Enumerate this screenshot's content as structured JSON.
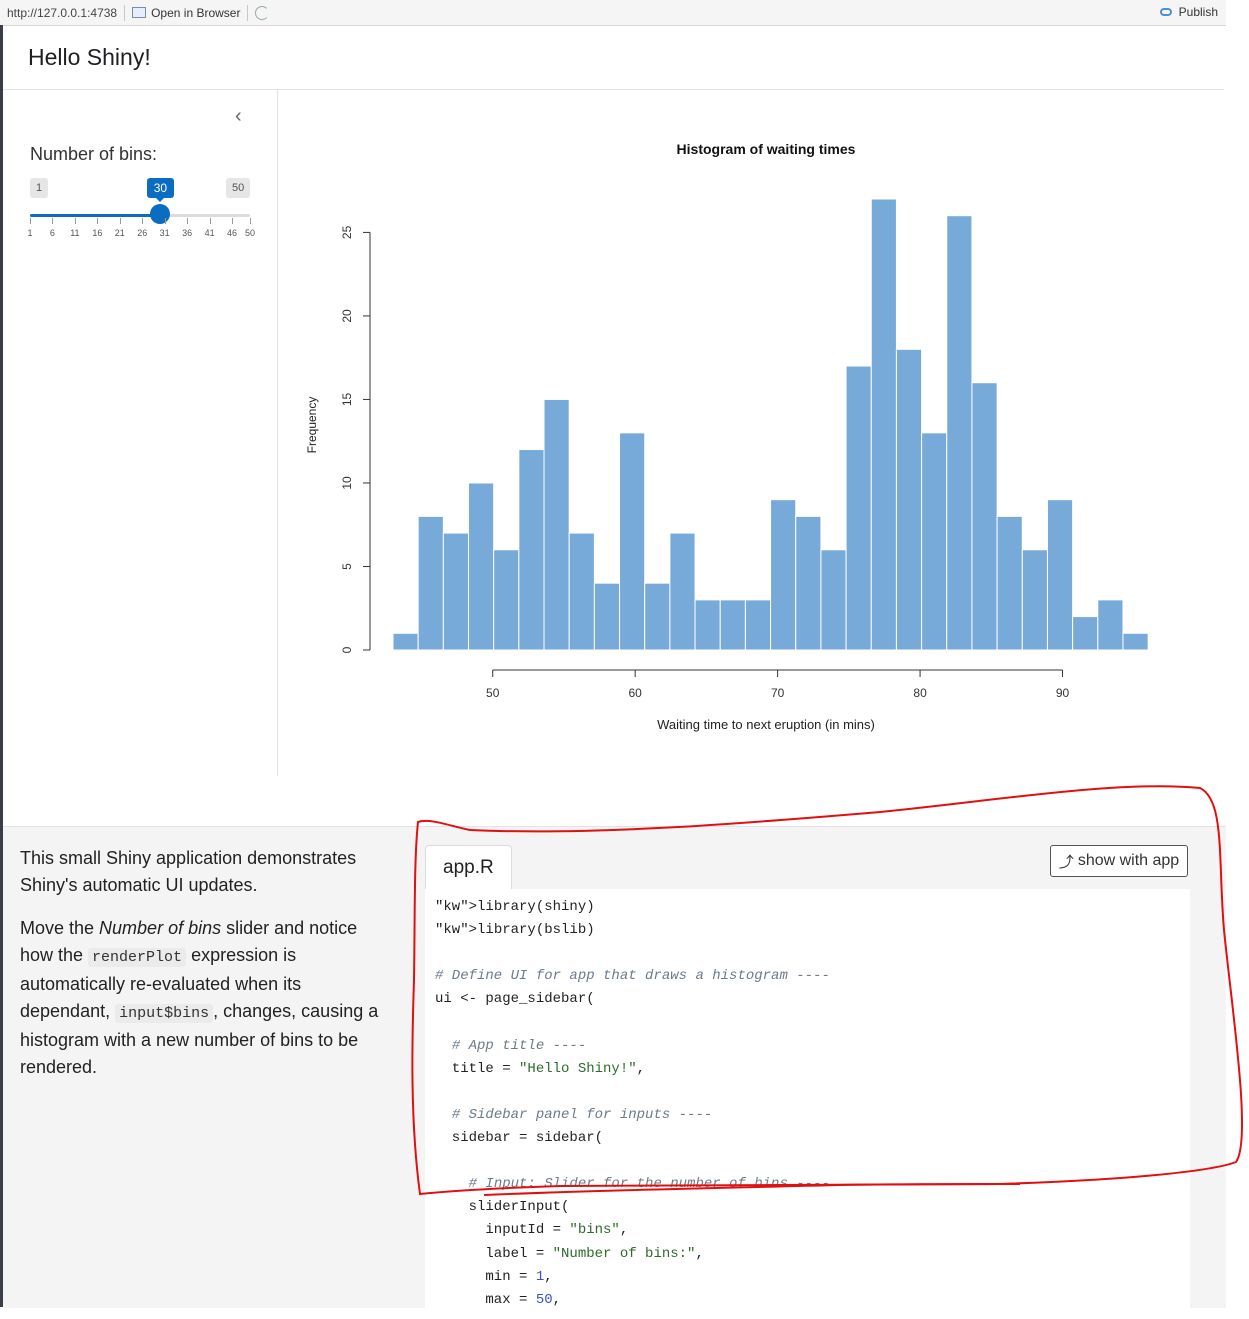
{
  "toolbar": {
    "url": "http://127.0.0.1:4738",
    "open_browser": "Open in Browser",
    "publish": "Publish"
  },
  "app": {
    "title": "Hello Shiny!"
  },
  "sidebar": {
    "slider_label": "Number of bins:",
    "min": 1,
    "max": 50,
    "value": 30,
    "min_label": "1",
    "max_label": "50",
    "value_label": "30",
    "tick_labels": [
      "1",
      "6",
      "11",
      "16",
      "21",
      "26",
      "31",
      "36",
      "41",
      "46",
      "50"
    ]
  },
  "chart_data": {
    "type": "bar",
    "title": "Histogram of waiting times",
    "xlabel": "Waiting time to next eruption (in mins)",
    "ylabel": "Frequency",
    "xlim": [
      43,
      96
    ],
    "ylim": [
      0,
      27
    ],
    "x_ticks": [
      50,
      60,
      70,
      80,
      90
    ],
    "y_ticks": [
      0,
      5,
      10,
      15,
      20,
      25
    ],
    "bin_start": 43.0,
    "bin_width": 1.767,
    "values": [
      1,
      8,
      7,
      10,
      6,
      12,
      15,
      7,
      4,
      13,
      4,
      7,
      3,
      3,
      3,
      9,
      8,
      6,
      17,
      27,
      18,
      13,
      26,
      16,
      8,
      6,
      9,
      2,
      3,
      1
    ],
    "bar_color": "#77a9d9"
  },
  "description": {
    "p1": "This small Shiny application demonstrates Shiny's automatic UI updates.",
    "p2_a": "Move the ",
    "p2_em": "Number of bins",
    "p2_b": " slider and notice how the ",
    "p2_code1": "renderPlot",
    "p2_c": " expression is automatically re-evaluated when its dependant, ",
    "p2_code2": "input$bins",
    "p2_d": ", changes, causing a histogram with a new number of bins to be rendered."
  },
  "code_panel": {
    "tab": "app.R",
    "show_with_app": "show with app",
    "lines": [
      "library(shiny)",
      "library(bslib)",
      "",
      "# Define UI for app that draws a histogram ----",
      "ui <- page_sidebar(",
      "",
      "  # App title ----",
      "  title = \"Hello Shiny!\",",
      "",
      "  # Sidebar panel for inputs ----",
      "  sidebar = sidebar(",
      "",
      "    # Input: Slider for the number of bins ----",
      "    sliderInput(",
      "      inputId = \"bins\",",
      "      label = \"Number of bins:\",",
      "      min = 1,",
      "      max = 50,"
    ]
  },
  "colors": {
    "accent": "#0b6dbf",
    "bars": "#77a9d9",
    "annotation": "#e01010"
  }
}
